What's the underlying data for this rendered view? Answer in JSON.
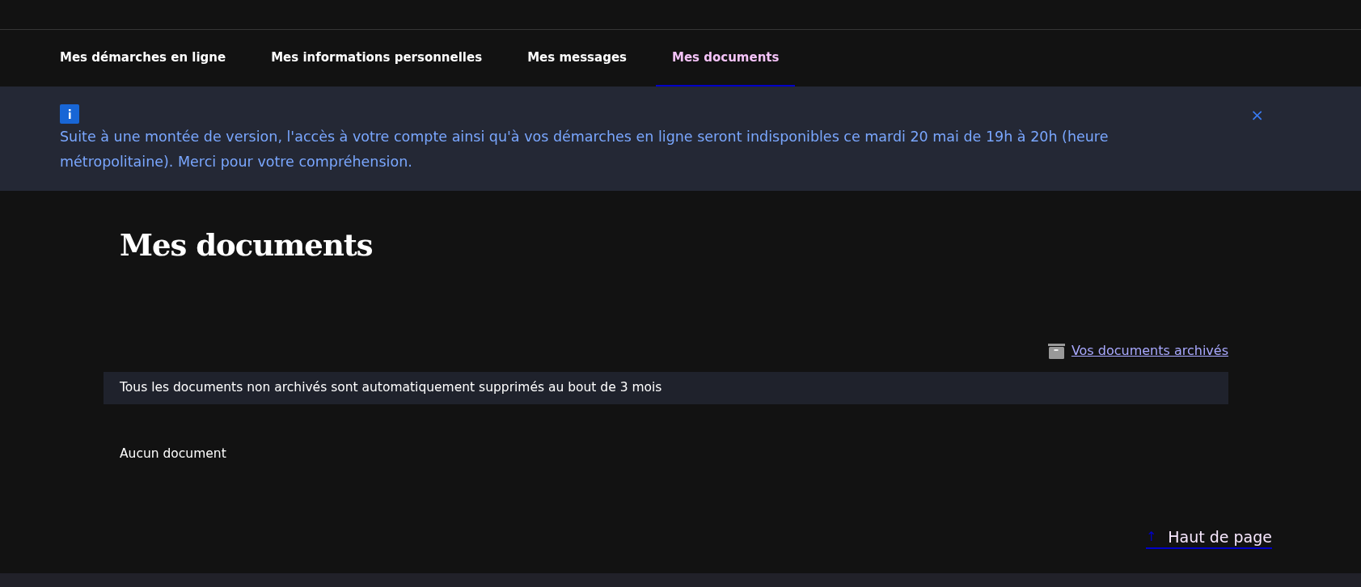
{
  "nav": {
    "tabs": [
      {
        "label": "Mes démarches en ligne",
        "selected": false
      },
      {
        "label": "Mes informations personnelles",
        "selected": false
      },
      {
        "label": "Mes messages",
        "selected": false
      },
      {
        "label": "Mes documents",
        "selected": true
      }
    ]
  },
  "notice": {
    "text": "Suite à une montée de version, l'accès à votre compte ainsi qu'à vos démarches en ligne seront indisponibles ce mardi 20 mai de 19h à 20h (heure métropolitaine). Merci pour votre compréhension.",
    "close": "×"
  },
  "page": {
    "title": "Mes documents",
    "archive_link": "Vos documents archivés",
    "info": "Tous les documents non archivés sont automatiquement supprimés au bout de 3 mois",
    "empty": "Aucun document"
  },
  "back_to_top": {
    "icon": "↑",
    "label": "Haut de page"
  }
}
